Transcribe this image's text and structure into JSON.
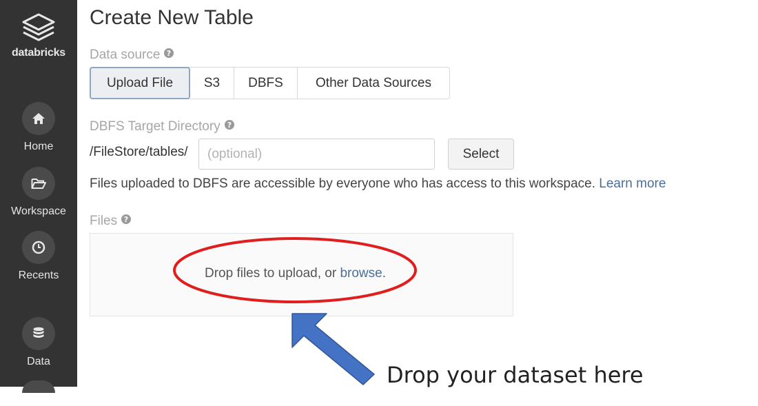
{
  "sidebar": {
    "brand_label": "databricks",
    "items": [
      {
        "label": "Home"
      },
      {
        "label": "Workspace"
      },
      {
        "label": "Recents"
      },
      {
        "label": "Data"
      }
    ]
  },
  "page": {
    "title": "Create New Table"
  },
  "data_source": {
    "label": "Data source",
    "tabs": [
      {
        "label": "Upload File",
        "active": true
      },
      {
        "label": "S3"
      },
      {
        "label": "DBFS"
      },
      {
        "label": "Other Data Sources"
      }
    ]
  },
  "dbfs_target": {
    "label": "DBFS Target Directory",
    "prefix": "/FileStore/tables/",
    "input_value": "",
    "input_placeholder": "(optional)",
    "select_label": "Select"
  },
  "info": {
    "text": "Files uploaded to DBFS are accessible by everyone who has access to this workspace.",
    "link": "Learn more"
  },
  "files": {
    "label": "Files",
    "drop_text": "Drop files to upload, or",
    "browse_link": "browse",
    "drop_suffix": "."
  },
  "annotation": {
    "text": "Drop your dataset here",
    "ellipse_color": "#e01e1e",
    "arrow_color": "#4472c4"
  },
  "colors": {
    "sidebar_bg": "#333333",
    "link": "#4b6f98",
    "active_tab_border": "#90a7c4"
  }
}
